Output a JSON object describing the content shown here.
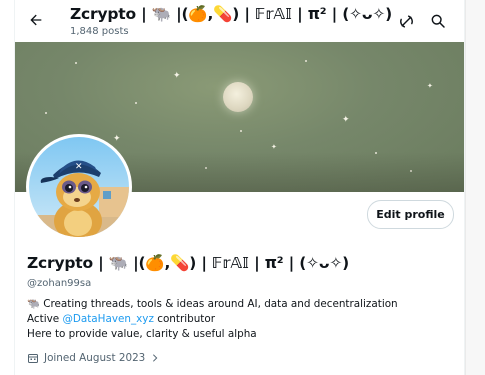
{
  "header": {
    "title": "Zcrypto | 🐃 |(🍊,💊) | 𝔽𝕣𝔸𝕀 | π² | (✧ᴗ✧)",
    "post_count": "1,848 posts"
  },
  "icons": {
    "back": "back-arrow-icon",
    "grok": "grok-icon",
    "search": "search-icon",
    "calendar": "calendar-icon"
  },
  "profile": {
    "display_name": "Zcrypto | 🐃 |(🍊,💊) | 𝔽𝕣𝔸𝕀 | π² | (✧ᴗ✧)",
    "handle": "@zohan99sa",
    "edit_button": "Edit profile",
    "bio_line1": "🐃 Creating threads, tools & ideas around AI, data and decentralization",
    "bio_line2_prefix": "Active ",
    "bio_line2_link": "@DataHaven_xyz",
    "bio_line2_suffix": " contributor",
    "bio_line3": "Here to provide value, clarity & useful alpha",
    "joined": "Joined August 2023"
  },
  "colors": {
    "accent": "#1d9bf0",
    "muted": "#536471",
    "text": "#0f1419"
  }
}
